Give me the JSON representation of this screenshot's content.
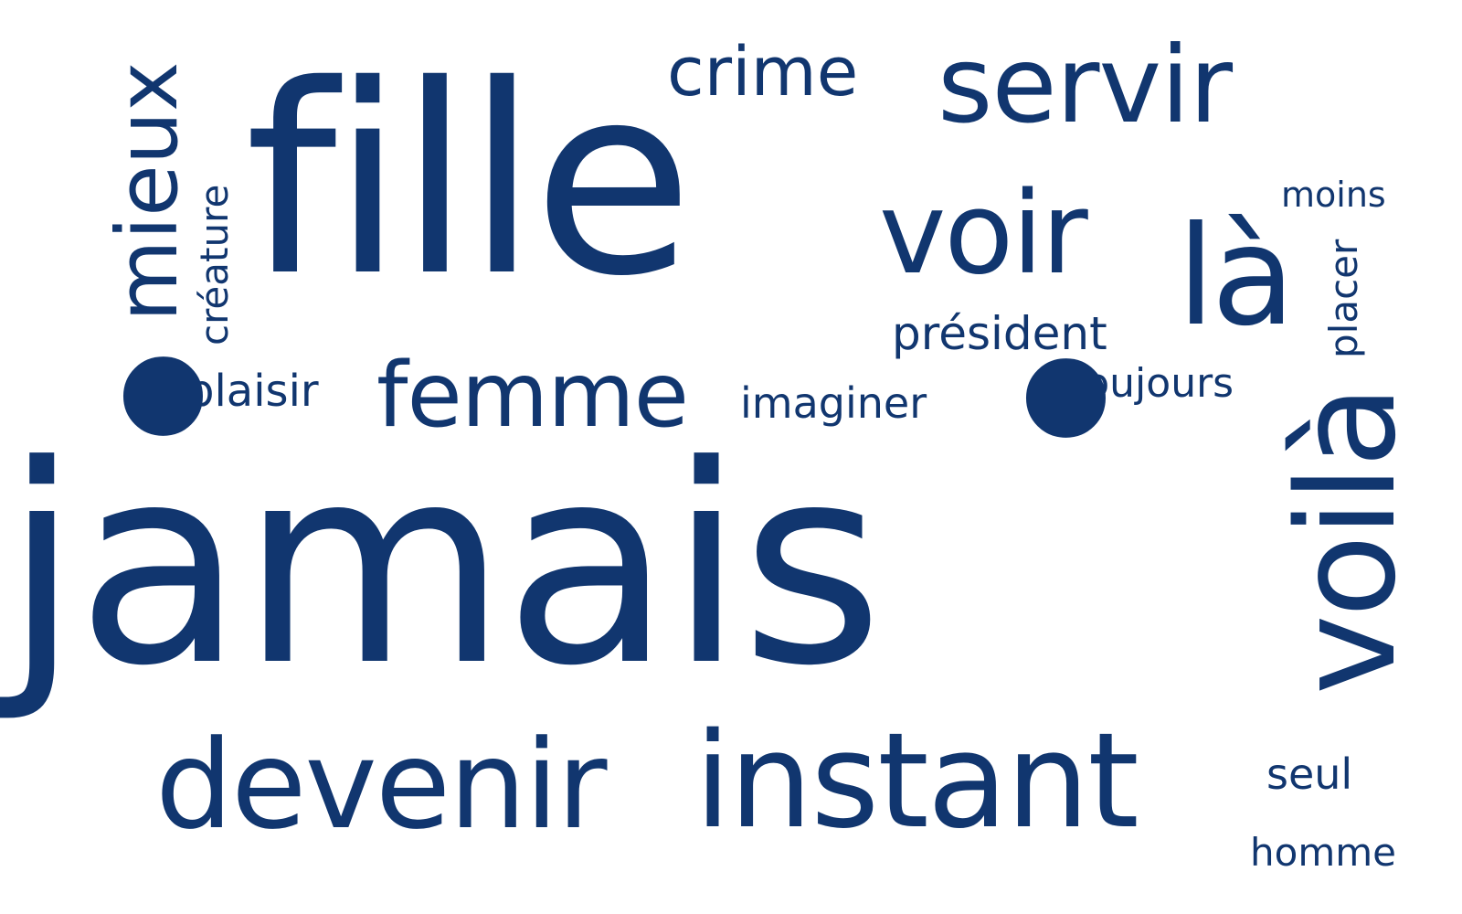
{
  "word_cloud": {
    "text_color": "#11366f",
    "background_color": "#ffffff",
    "words": {
      "jamais": "jamais",
      "fille": "fille",
      "devenir": "devenir",
      "instant": "instant",
      "servir": "servir",
      "crime": "crime",
      "voir": "voir",
      "la": "là",
      "femme": "femme",
      "imaginer": "imaginer",
      "plaisir": "plaisir",
      "president": "président",
      "toujours": "toujours",
      "moins": "moins",
      "seul": "seul",
      "homme": "homme",
      "mieux": "mieux",
      "creature": "créature",
      "placer": "placer",
      "voila": "voilà",
      "dot_left": "•",
      "dot_mid": "•"
    }
  }
}
